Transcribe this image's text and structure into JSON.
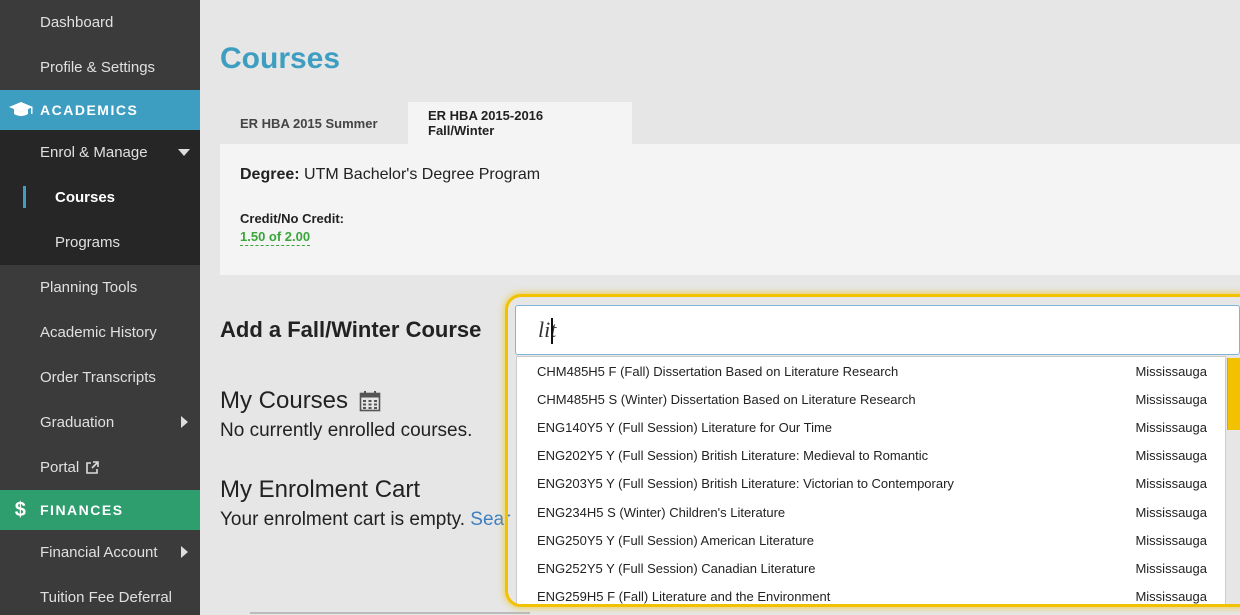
{
  "sidebar": {
    "items_top": [
      "Dashboard",
      "Profile & Settings"
    ],
    "academics": {
      "label": "ACADEMICS",
      "icon": "graduation-cap-icon",
      "enrol_manage": "Enrol & Manage",
      "courses": "Courses",
      "programs": "Programs"
    },
    "items_mid": [
      "Planning Tools",
      "Academic History",
      "Order Transcripts",
      "Graduation",
      "Portal"
    ],
    "finances": {
      "label": "FINANCES",
      "icon": "dollar-icon",
      "items": [
        "Financial Account",
        "Tuition Fee Deferral"
      ]
    },
    "colors": {
      "bg": "#3b3b3b",
      "academics": "#3d9ec1",
      "finances": "#2e9e6e"
    }
  },
  "main": {
    "title": "Courses",
    "tabs": [
      {
        "label": "ER HBA 2015 Summer",
        "active": false
      },
      {
        "label": "ER HBA 2015-2016 Fall/Winter",
        "active": true
      }
    ],
    "degree": {
      "label": "Degree:",
      "value": "UTM Bachelor's Degree Program",
      "credit_label": "Credit/No Credit:",
      "credit_value": "1.50 of 2.00"
    },
    "add_heading": "Add a Fall/Winter Course",
    "search": {
      "value": "lit"
    },
    "my_courses": {
      "heading": "My Courses",
      "empty_text": "No currently enrolled courses."
    },
    "cart": {
      "heading": "My Enrolment Cart",
      "empty_text": "Your enrolment cart is empty.",
      "link_text": "Sear"
    }
  },
  "dropdown": {
    "results": [
      {
        "course": "CHM485H5 F (Fall) Dissertation Based on Literature Research",
        "campus": "Mississauga"
      },
      {
        "course": "CHM485H5 S (Winter) Dissertation Based on Literature Research",
        "campus": "Mississauga"
      },
      {
        "course": "ENG140Y5 Y (Full Session) Literature for Our Time",
        "campus": "Mississauga"
      },
      {
        "course": "ENG202Y5 Y (Full Session) British Literature: Medieval to Romantic",
        "campus": "Mississauga"
      },
      {
        "course": "ENG203Y5 Y (Full Session) British Literature: Victorian to Contemporary",
        "campus": "Mississauga"
      },
      {
        "course": "ENG234H5 S (Winter) Children's Literature",
        "campus": "Mississauga"
      },
      {
        "course": "ENG250Y5 Y (Full Session) American Literature",
        "campus": "Mississauga"
      },
      {
        "course": "ENG252Y5 Y (Full Session) Canadian Literature",
        "campus": "Mississauga"
      },
      {
        "course": "ENG259H5 F (Fall) Literature and the Environment",
        "campus": "Mississauga"
      }
    ]
  },
  "colors": {
    "accent": "#3d9ec1",
    "credit": "#3aa63a",
    "focus": "#f2c200"
  }
}
